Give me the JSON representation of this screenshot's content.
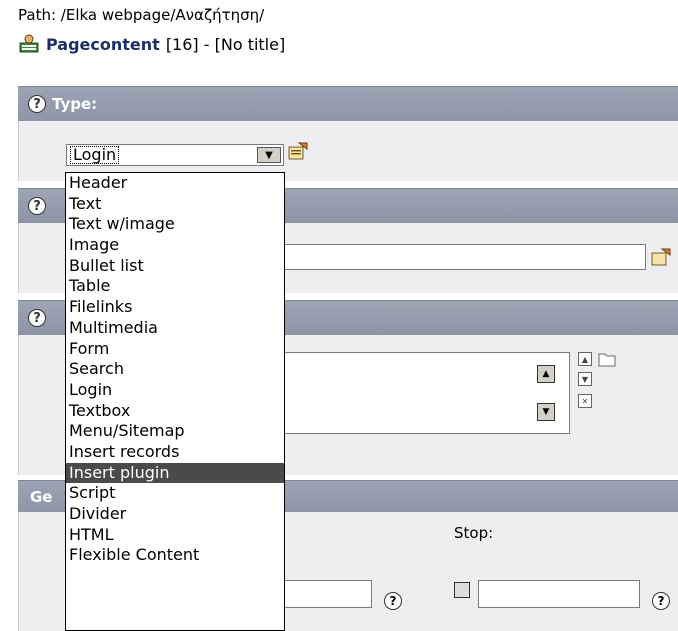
{
  "path": {
    "label": "Path:",
    "value": "/Elka webpage/Αναζήτηση/"
  },
  "record": {
    "title": "Pagecontent",
    "rest": "[16] - [No title]"
  },
  "sections": {
    "type_header": "Type:",
    "general_header_visible": "Ge"
  },
  "type_select": {
    "value": "Login",
    "options": [
      "Header",
      "Text",
      "Text w/image",
      "Image",
      "Bullet list",
      "Table",
      "Filelinks",
      "Multimedia",
      "Form",
      "Search",
      "Login",
      "Textbox",
      "Menu/Sitemap",
      "Insert records",
      "Insert plugin",
      "Script",
      "Divider",
      "HTML",
      "Flexible Content"
    ],
    "highlighted": "Insert plugin"
  },
  "icons": {
    "help": "?",
    "help_icon": "help-icon",
    "edit_icon": "edit-record-icon",
    "folder_icon": "folder-icon",
    "delete_icon": "delete-x-icon",
    "page_icon": "pagecontent-icon"
  },
  "fields": {
    "stop_label": "Stop:"
  },
  "colors": {
    "header_bg": "#959cad",
    "body_bg": "#eeeef0",
    "title_color": "#1c2f6b",
    "highlight": "#4a4a4a"
  }
}
